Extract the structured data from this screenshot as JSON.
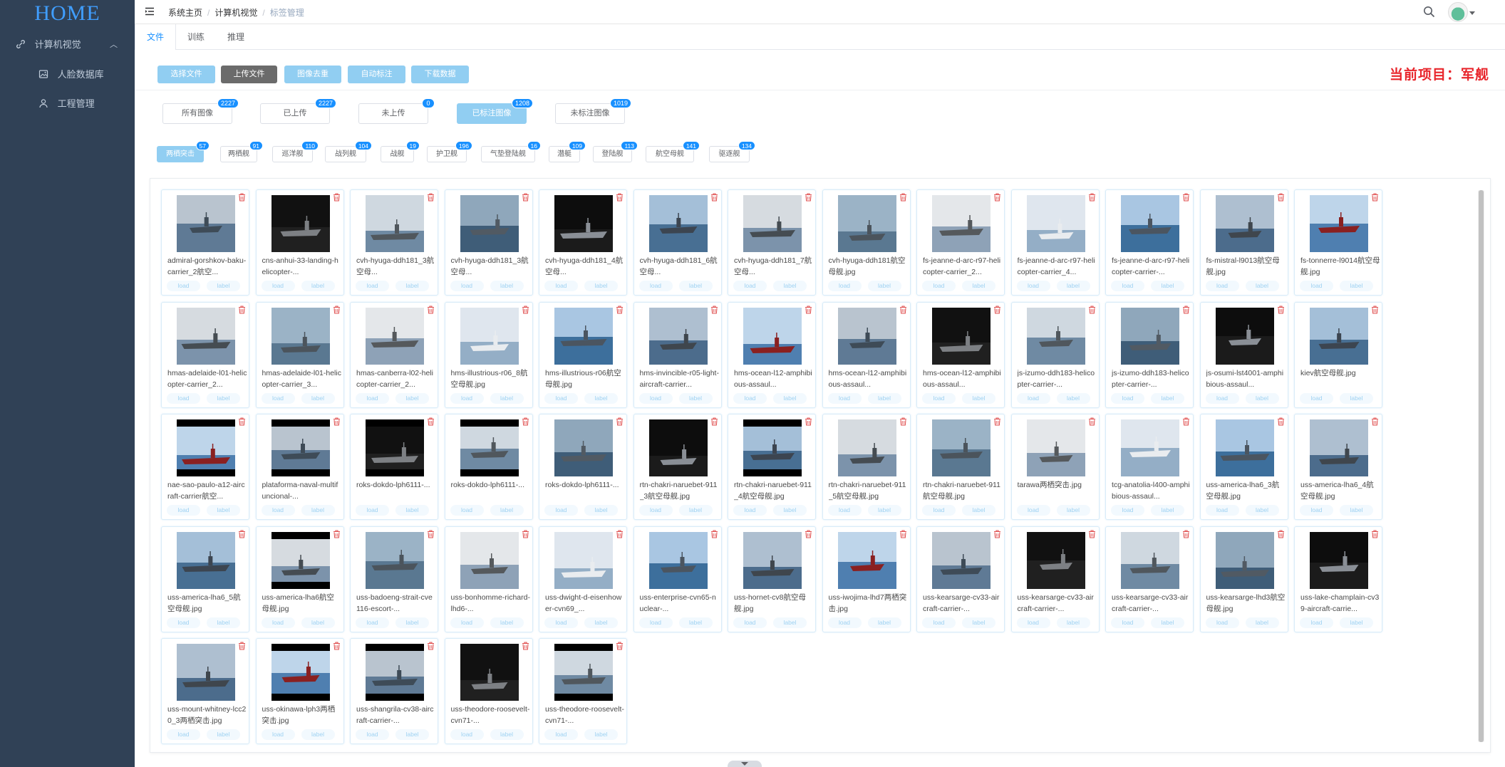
{
  "sidebar": {
    "logo": "HOME",
    "group": {
      "label": "计算机视觉",
      "icon": "link-icon"
    },
    "items": [
      {
        "label": "人脸数据库",
        "icon": "image-icon"
      },
      {
        "label": "工程管理",
        "icon": "user-icon"
      }
    ]
  },
  "navbar": {
    "breadcrumb": [
      "系统主页",
      "计算机视觉",
      "标签管理"
    ]
  },
  "tabs": [
    "文件",
    "训练",
    "推理"
  ],
  "toolbar": {
    "buttons": [
      "选择文件",
      "上传文件",
      "图像去重",
      "自动标注",
      "下载数据"
    ],
    "project": "当前项目：军舰"
  },
  "filters": [
    {
      "label": "所有图像",
      "count": "2227"
    },
    {
      "label": "已上传",
      "count": "2227"
    },
    {
      "label": "未上传",
      "count": "0"
    },
    {
      "label": "已标注图像",
      "count": "1208"
    },
    {
      "label": "未标注图像",
      "count": "1019"
    }
  ],
  "categories": [
    {
      "label": "两栖突击",
      "count": "57"
    },
    {
      "label": "两栖舰",
      "count": "91"
    },
    {
      "label": "巡洋舰",
      "count": "110"
    },
    {
      "label": "战列舰",
      "count": "104"
    },
    {
      "label": "战舰",
      "count": "19"
    },
    {
      "label": "护卫舰",
      "count": "196"
    },
    {
      "label": "气垫登陆舰",
      "count": "16"
    },
    {
      "label": "潜艇",
      "count": "109"
    },
    {
      "label": "登陆舰",
      "count": "113"
    },
    {
      "label": "航空母舰",
      "count": "141"
    },
    {
      "label": "驱逐舰",
      "count": "134"
    }
  ],
  "card_buttons": {
    "load": "load",
    "label": "label"
  },
  "files": [
    "admiral-gorshkov-baku-carrier_2航空...",
    "cns-anhui-33-landing-helicopter-...",
    "cvh-hyuga-ddh181_3航空母...",
    "cvh-hyuga-ddh181_3航空母...",
    "cvh-hyuga-ddh181_4航空母...",
    "cvh-hyuga-ddh181_6航空母...",
    "cvh-hyuga-ddh181_7航空母...",
    "cvh-hyuga-ddh181航空母舰.jpg",
    "fs-jeanne-d-arc-r97-helicopter-carrier_2...",
    "fs-jeanne-d-arc-r97-helicopter-carrier_4...",
    "fs-jeanne-d-arc-r97-helicopter-carrier-...",
    "fs-mistral-l9013航空母舰.jpg",
    "fs-tonnerre-l9014航空母舰.jpg",
    "hmas-adelaide-l01-helicopter-carrier_2...",
    "hmas-adelaide-l01-helicopter-carrier_3...",
    "hmas-canberra-l02-helicopter-carrier_2...",
    "hms-illustrious-r06_8航空母舰.jpg",
    "hms-illustrious-r06航空母舰.jpg",
    "hms-invincible-r05-light-aircraft-carrier...",
    "hms-ocean-l12-amphibious-assaul...",
    "hms-ocean-l12-amphibious-assaul...",
    "hms-ocean-l12-amphibious-assaul...",
    "js-izumo-ddh183-helicopter-carrier-...",
    "js-izumo-ddh183-helicopter-carrier-...",
    "js-osumi-lst4001-amphibious-assaul...",
    "kiev航空母舰.jpg",
    "nae-sao-paulo-a12-aircraft-carrier航空...",
    "plataforma-naval-multifuncional-...",
    "roks-dokdo-lph6111-...",
    "roks-dokdo-lph6111-...",
    "roks-dokdo-lph6111-...",
    "rtn-chakri-naruebet-911_3航空母舰.jpg",
    "rtn-chakri-naruebet-911_4航空母舰.jpg",
    "rtn-chakri-naruebet-911_5航空母舰.jpg",
    "rtn-chakri-naruebet-911航空母舰.jpg",
    "tarawa两栖突击.jpg",
    "tcg-anatolia-l400-amphibious-assaul...",
    "uss-america-lha6_3航空母舰.jpg",
    "uss-america-lha6_4航空母舰.jpg",
    "uss-america-lha6_5航空母舰.jpg",
    "uss-america-lha6航空母舰.jpg",
    "uss-badoeng-strait-cve116-escort-...",
    "uss-bonhomme-richard-lhd6-...",
    "uss-dwight-d-eisenhower-cvn69_...",
    "uss-enterprise-cvn65-nuclear-...",
    "uss-hornet-cv8航空母舰.jpg",
    "uss-iwojima-lhd7两栖突击.jpg",
    "uss-kearsarge-cv33-aircraft-carrier-...",
    "uss-kearsarge-cv33-aircraft-carrier-...",
    "uss-kearsarge-cv33-aircraft-carrier-...",
    "uss-kearsarge-lhd3航空母舰.jpg",
    "uss-lake-champlain-cv39-aircraft-carrie...",
    "uss-mount-whitney-lcc20_3两栖突击.jpg",
    "uss-okinawa-lph3两栖突击.jpg",
    "uss-shangrila-cv38-aircraft-carrier-...",
    "uss-theodore-roosevelt-cvn71-...",
    "uss-theodore-roosevelt-cvn71-..."
  ]
}
